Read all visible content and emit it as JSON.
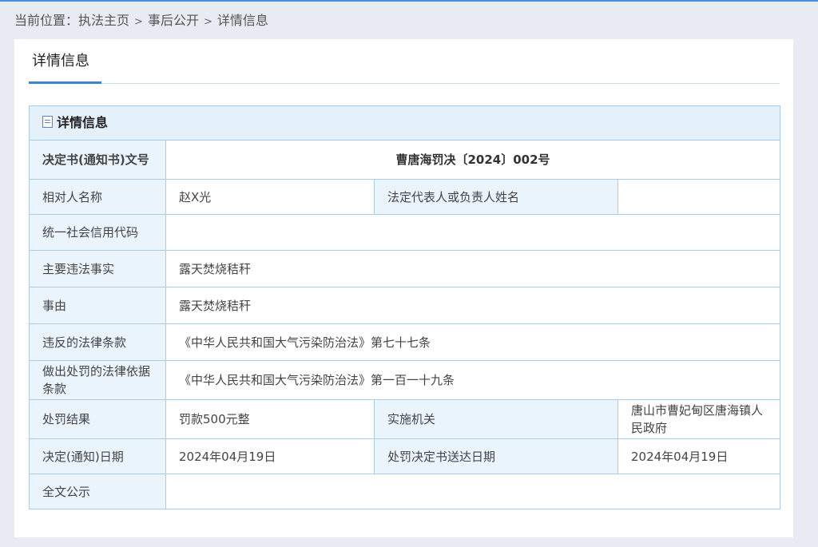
{
  "breadcrumb": {
    "prefix": "当前位置：",
    "items": [
      "执法主页",
      "事后公开",
      "详情信息"
    ],
    "separator": ">"
  },
  "tab": {
    "title": "详情信息"
  },
  "table": {
    "title": "详情信息",
    "rows": {
      "doc_no": {
        "label": "决定书(通知书)文号",
        "value": "曹唐海罚决〔2024〕002号"
      },
      "party": {
        "label": "相对人名称",
        "value": "赵X光",
        "label2": "法定代表人或负责人姓名",
        "value2": ""
      },
      "credit_code": {
        "label": "统一社会信用代码",
        "value": ""
      },
      "facts": {
        "label": "主要违法事实",
        "value": "露天焚烧秸秆"
      },
      "reason": {
        "label": "事由",
        "value": "露天焚烧秸秆"
      },
      "violated_law": {
        "label": "违反的法律条款",
        "value": "《中华人民共和国大气污染防治法》第七十七条"
      },
      "penalty_basis": {
        "label": "做出处罚的法律依据条款",
        "value": "《中华人民共和国大气污染防治法》第一百一十九条"
      },
      "result": {
        "label": "处罚结果",
        "value": "罚款500元整",
        "label2": "实施机关",
        "value2": "唐山市曹妃甸区唐海镇人民政府"
      },
      "dates": {
        "label": "决定(通知)日期",
        "value": "2024年04月19日",
        "label2": "处罚决定书送达日期",
        "value2": "2024年04月19日"
      },
      "disclosure": {
        "label": "全文公示",
        "value": ""
      }
    }
  },
  "colors": {
    "accent": "#3a86c8",
    "border": "#a9cde8",
    "label_bg": "#eaf4fc",
    "header_bg": "#e4f0fa",
    "page_bg": "#e8ebf1"
  },
  "icons": {
    "table_title_icon": "document-icon"
  }
}
